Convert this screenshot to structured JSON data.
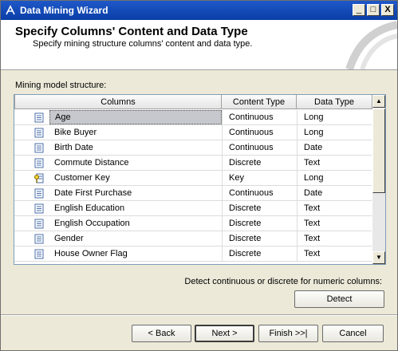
{
  "window": {
    "title": "Data Mining Wizard",
    "caption_buttons": {
      "minimize": "_",
      "maximize": "□",
      "close": "X"
    }
  },
  "header": {
    "title": "Specify Columns' Content and Data Type",
    "subtitle": "Specify mining structure columns' content and data type."
  },
  "grid": {
    "label": "Mining model structure:",
    "headers": {
      "columns": "Columns",
      "content_type": "Content Type",
      "data_type": "Data Type"
    },
    "rows": [
      {
        "name": "Age",
        "content_type": "Continuous",
        "data_type": "Long",
        "icon": "column-icon",
        "selected": true
      },
      {
        "name": "Bike Buyer",
        "content_type": "Continuous",
        "data_type": "Long",
        "icon": "column-icon"
      },
      {
        "name": "Birth Date",
        "content_type": "Continuous",
        "data_type": "Date",
        "icon": "column-icon"
      },
      {
        "name": "Commute Distance",
        "content_type": "Discrete",
        "data_type": "Text",
        "icon": "column-icon"
      },
      {
        "name": "Customer Key",
        "content_type": "Key",
        "data_type": "Long",
        "icon": "key-icon"
      },
      {
        "name": "Date First Purchase",
        "content_type": "Continuous",
        "data_type": "Date",
        "icon": "column-icon"
      },
      {
        "name": "English Education",
        "content_type": "Discrete",
        "data_type": "Text",
        "icon": "column-icon"
      },
      {
        "name": "English Occupation",
        "content_type": "Discrete",
        "data_type": "Text",
        "icon": "column-icon"
      },
      {
        "name": "Gender",
        "content_type": "Discrete",
        "data_type": "Text",
        "icon": "column-icon"
      },
      {
        "name": "House Owner Flag",
        "content_type": "Discrete",
        "data_type": "Text",
        "icon": "column-icon"
      }
    ]
  },
  "detect": {
    "label": "Detect continuous or discrete for numeric columns:",
    "button": "Detect"
  },
  "footer": {
    "back": "< Back",
    "next": "Next >",
    "finish": "Finish >>|",
    "cancel": "Cancel"
  },
  "colors": {
    "titlebar": "#0a3ea7",
    "selection": "#c6c8cd"
  }
}
